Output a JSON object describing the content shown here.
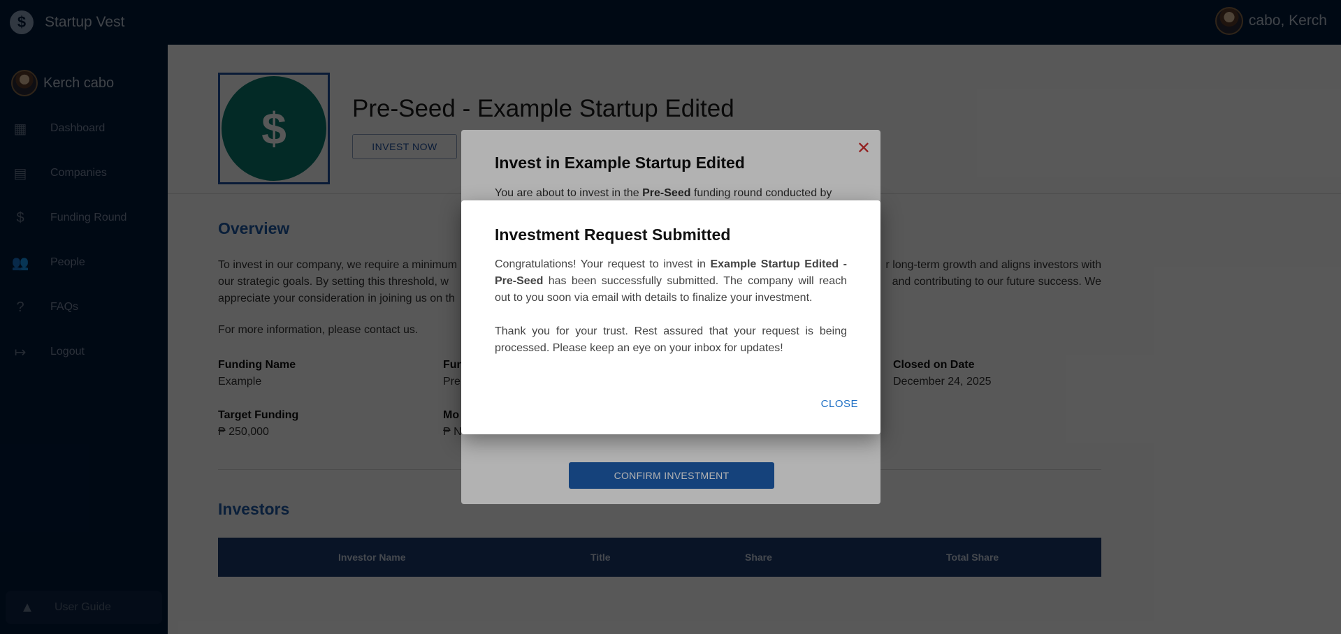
{
  "app": {
    "name": "Startup Vest",
    "logo_glyph": "$"
  },
  "topbar": {
    "user_name": "cabo, Kerch"
  },
  "sidebar": {
    "user_name": "Kerch cabo",
    "items": [
      {
        "label": "Dashboard",
        "icon": "dashboard-icon",
        "glyph": "▦"
      },
      {
        "label": "Companies",
        "icon": "store-icon",
        "glyph": "▤"
      },
      {
        "label": "Funding Round",
        "icon": "dollar-circle-icon",
        "glyph": "$"
      },
      {
        "label": "People",
        "icon": "people-icon",
        "glyph": "👥"
      },
      {
        "label": "FAQs",
        "icon": "help-circle-icon",
        "glyph": "?"
      },
      {
        "label": "Logout",
        "icon": "logout-icon",
        "glyph": "↦"
      }
    ],
    "guide": {
      "label": "User Guide",
      "icon": "navigation-icon",
      "glyph": "▲"
    }
  },
  "page": {
    "title": "Pre-Seed - Example Startup Edited",
    "invest_button": "INVEST NOW",
    "overview_heading": "Overview",
    "overview_visible_lines": [
      "To invest in our company, we require a minimum",
      "our strategic goals. By setting this threshold, w",
      "appreciate your consideration in joining us on th"
    ],
    "overview_right_lines": [
      "r long-term growth and aligns investors with",
      "and contributing to our future success. We"
    ],
    "contact": "For more information, please contact us.",
    "fields": {
      "funding_name_label": "Funding Name",
      "funding_name_value": "Example",
      "funding_type_label_partial": "Fun",
      "funding_type_value_partial": "Pre",
      "closed_label": "Closed on Date",
      "closed_value": "December 24, 2025",
      "target_label": "Target Funding",
      "target_value": "₱ 250,000",
      "money_label_partial": "Mo",
      "money_value_partial": "₱ N"
    },
    "investors_heading": "Investors",
    "table_headers": [
      "Investor Name",
      "Title",
      "Share",
      "Total Share"
    ]
  },
  "invest_modal": {
    "title": "Invest in Example Startup Edited",
    "text_prefix": "You are about to invest in the ",
    "text_round": "Pre-Seed",
    "text_suffix": " funding round conducted by",
    "close_glyph": "✕",
    "confirm_button": "CONFIRM INVESTMENT"
  },
  "success_modal": {
    "title": "Investment Request Submitted",
    "p1_a": "Congratulations! Your request to invest in ",
    "p1_bold": "Example Startup Edited - Pre-Seed",
    "p1_b": " has been successfully submitted. The company will reach out to you soon via email with details to finalize your investment.",
    "p2": "Thank you for your trust. Rest assured that your request is being processed. Please keep an eye on your inbox for updates!",
    "close_button": "CLOSE"
  }
}
